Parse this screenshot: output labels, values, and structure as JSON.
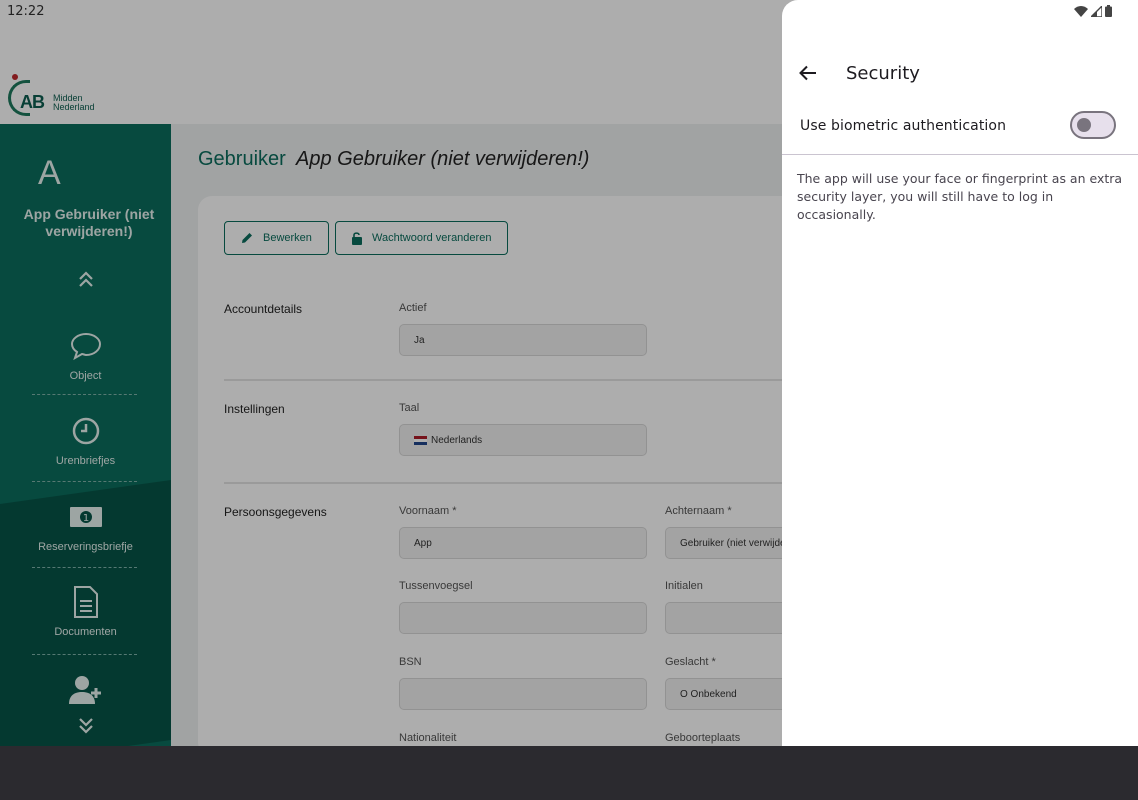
{
  "status_bar": {
    "time": "12:22"
  },
  "logo": {
    "initials": "AB",
    "line1": "Midden",
    "line2": "Nederland"
  },
  "sidebar": {
    "initial": "A",
    "user_name": "App Gebruiker (niet verwijderen!)",
    "items": [
      {
        "label": "Object",
        "icon": "speech-bubble-icon"
      },
      {
        "label": "Urenbriefjes",
        "icon": "clock-icon"
      },
      {
        "label": "Reserveringsbriefje",
        "icon": "banknote-icon"
      },
      {
        "label": "Documenten",
        "icon": "document-icon"
      }
    ]
  },
  "page": {
    "breadcrumb": "Gebruiker",
    "subtitle": "App Gebruiker (niet verwijderen!)",
    "edit_button": "Bewerken",
    "password_button": "Wachtwoord veranderen"
  },
  "sections": {
    "account": {
      "label": "Accountdetails",
      "active_label": "Actief",
      "active_value": "Ja"
    },
    "settings": {
      "label": "Instellingen",
      "language_label": "Taal",
      "language_value": "Nederlands"
    },
    "personal": {
      "label": "Persoonsgegevens",
      "first_name_label": "Voornaam *",
      "first_name_value": "App",
      "last_name_label": "Achternaam *",
      "last_name_value": "Gebruiker (niet verwijde",
      "infix_label": "Tussenvoegsel",
      "infix_value": "",
      "initials_label": "Initialen",
      "initials_value": "",
      "bsn_label": "BSN",
      "bsn_value": "",
      "gender_label": "Geslacht *",
      "gender_value": "O Onbekend",
      "nationality_label": "Nationaliteit",
      "birthplace_label": "Geboorteplaats"
    }
  },
  "security_panel": {
    "title": "Security",
    "biometric_label": "Use biometric authentication",
    "biometric_enabled": false,
    "description": "The app will use your face or fingerprint as an extra security layer, you will still have to log in occasionally."
  },
  "colors": {
    "primary": "#0b6d5d",
    "scrim": "rgba(0,0,0,0.32)",
    "nav_bar": "#2b2a2f"
  }
}
